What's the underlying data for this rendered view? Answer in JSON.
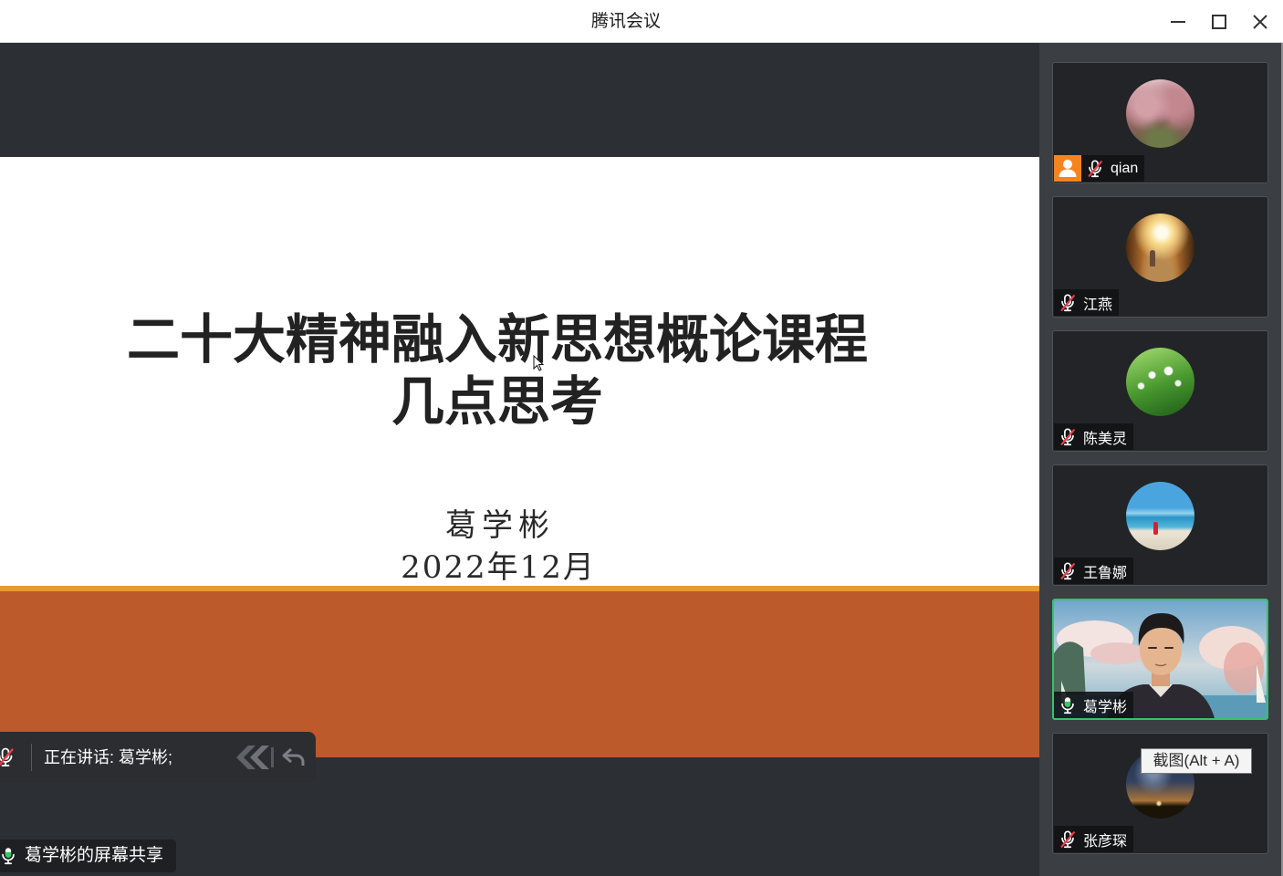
{
  "window": {
    "title": "腾讯会议",
    "controls": [
      "minimize-icon",
      "maximize-icon",
      "close-icon"
    ]
  },
  "shared_screen": {
    "slide": {
      "title_lines": [
        "二十大精神融入新思想概论课程",
        "几点思考"
      ],
      "author": "葛学彬",
      "date": "2022年12月"
    }
  },
  "speaking_bar": {
    "mic_icon": "mic-muted-icon",
    "label": "正在讲话: 葛学彬;",
    "tool_icons": [
      "diamond-icon",
      "undo-icon"
    ]
  },
  "share_badge": {
    "mic_icon": "mic-on-icon",
    "label": "葛学彬的屏幕共享"
  },
  "participants": [
    {
      "name": "qian",
      "mic_icon": "mic-muted-icon",
      "badge_icon": "host-icon"
    },
    {
      "name": "江燕",
      "mic_icon": "mic-muted-icon"
    },
    {
      "name": "陈美灵",
      "mic_icon": "mic-muted-icon"
    },
    {
      "name": "王鲁娜",
      "mic_icon": "mic-muted-icon"
    },
    {
      "name": "葛学彬",
      "mic_icon": "mic-on-icon",
      "active_speaker": true,
      "video_on": true
    },
    {
      "name": "张彦琛",
      "mic_icon": "mic-muted-icon"
    }
  ],
  "tooltip": {
    "text": "截图(Alt + A)"
  },
  "colors": {
    "titlebar_bg": "#ffffff",
    "stage_bg": "#2c2f33",
    "sidebar_bg": "#3b3e42",
    "slide_bg": "#ffffff",
    "slide_accent_line": "#e59b31",
    "slide_band": "#bc5a2c",
    "active_speaker_border": "#35c46a",
    "host_badge": "#f5841f",
    "mic_muted_slash": "#ef3e4a",
    "mic_active": "#2fcf5b"
  }
}
